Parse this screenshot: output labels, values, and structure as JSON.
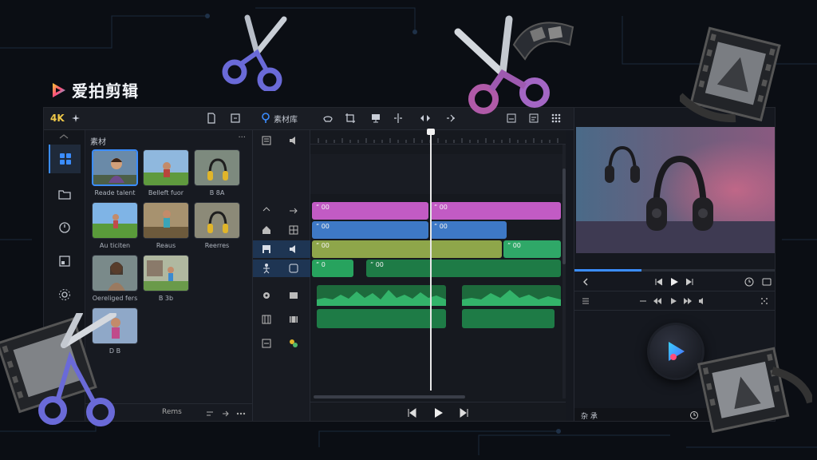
{
  "app": {
    "name": "爱拍剪辑",
    "colors": {
      "accent": "#3b8dff",
      "bg": "#0b0e14",
      "panel": "#15181f"
    }
  },
  "toolbar": {
    "resolution_label": "4K",
    "library_label": "素材库",
    "icons": [
      "file-icon",
      "export-icon",
      "cut-tool-icon",
      "crop-tool-icon",
      "monitor-icon",
      "split-icon",
      "trim-icon",
      "audio-icon",
      "subtitle-icon",
      "caption-icon",
      "grid-icon"
    ]
  },
  "media_panel": {
    "title": "素材",
    "more_label": "···",
    "items": [
      {
        "label": "Reade talent"
      },
      {
        "label": "Belleft fuor"
      },
      {
        "label": "B 8A"
      },
      {
        "label": "Au ticiten"
      },
      {
        "label": "Reaus"
      },
      {
        "label": "Reerres"
      },
      {
        "label": "Oereliged fers"
      },
      {
        "label": "B 3b"
      },
      {
        "label": "D B"
      }
    ],
    "footer_label": "Rems"
  },
  "timeline": {
    "clips": [
      {
        "label": "ˮ 00",
        "color": "#c25bc4"
      },
      {
        "label": "ˮ 00",
        "color": "#c25bc4"
      },
      {
        "label": "ˮ 00",
        "color": "#3e79c6"
      },
      {
        "label": "ˮ 00",
        "color": "#3e79c6"
      },
      {
        "label": "ˮ 00",
        "color": "#8ea64a"
      },
      {
        "label": "ˮ 00",
        "color": "#2fa868"
      },
      {
        "label": "ˮ 0",
        "color": "#27a35e"
      },
      {
        "label": "ˮ 00",
        "color": "#1e7b46"
      }
    ]
  },
  "preview": {
    "progress": 0.33,
    "status_left": "杂 承",
    "status_right_icon": "clock-icon"
  }
}
